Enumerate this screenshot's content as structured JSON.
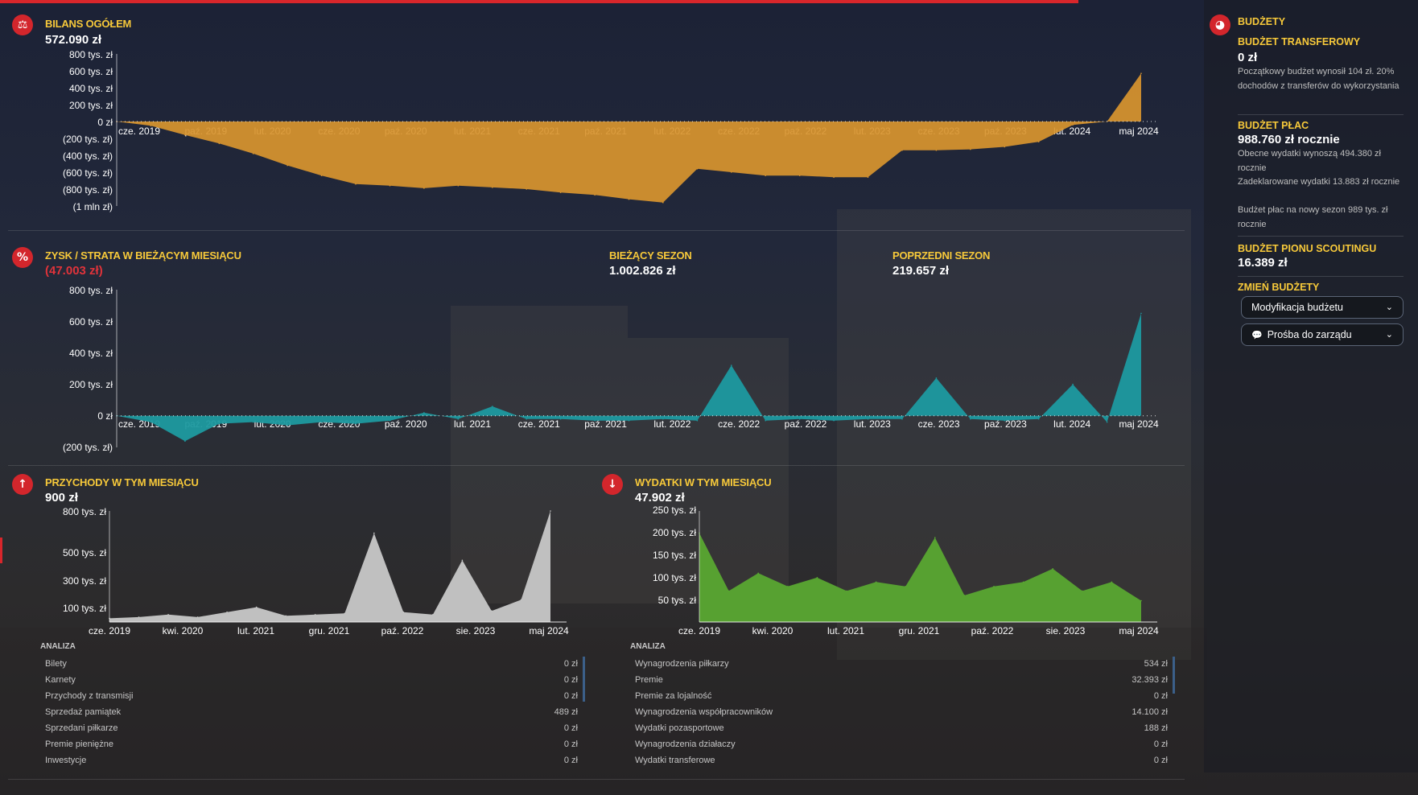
{
  "balance": {
    "title": "BILANS OGÓŁEM",
    "value": "572.090 zł",
    "icon": "balance-icon",
    "color": "#d9952f",
    "y_labels": [
      "800 tys. zł",
      "600 tys. zł",
      "400 tys. zł",
      "200 tys. zł",
      "0 zł",
      "(200 tys. zł)",
      "(400 tys. zł)",
      "(600 tys. zł)",
      "(800 tys. zł)",
      "(1 mln zł)"
    ],
    "x_labels": [
      "cze. 2019",
      "paź. 2019",
      "lut. 2020",
      "cze. 2020",
      "paź. 2020",
      "lut. 2021",
      "cze. 2021",
      "paź. 2021",
      "lut. 2022",
      "cze. 2022",
      "paź. 2022",
      "lut. 2023",
      "cze. 2023",
      "paź. 2023",
      "lut. 2024",
      "maj 2024"
    ]
  },
  "profit": {
    "title": "ZYSK / STRATA W BIEŻĄCYM MIESIĄCU",
    "value": "(47.003 zł)",
    "icon": "percent-icon",
    "color": "#1d9aa0",
    "current_season_label": "BIEŻĄCY SEZON",
    "current_season_value": "1.002.826 zł",
    "previous_season_label": "POPRZEDNI SEZON",
    "previous_season_value": "219.657 zł",
    "y_labels": [
      "800 tys. zł",
      "600 tys. zł",
      "400 tys. zł",
      "200 tys. zł",
      "0 zł",
      "(200 tys. zł)"
    ],
    "x_labels": [
      "cze. 2019",
      "paź. 2019",
      "lut. 2020",
      "cze. 2020",
      "paź. 2020",
      "lut. 2021",
      "cze. 2021",
      "paź. 2021",
      "lut. 2022",
      "cze. 2022",
      "paź. 2022",
      "lut. 2023",
      "cze. 2023",
      "paź. 2023",
      "lut. 2024",
      "maj 2024"
    ]
  },
  "income": {
    "title": "PRZYCHODY W TYM MIESIĄCU",
    "value": "900 zł",
    "icon": "arrow-up-icon",
    "color": "#c8c8c8",
    "y_labels": [
      "800 tys. zł",
      "500 tys. zł",
      "300 tys. zł",
      "100 tys. zł"
    ],
    "x_labels": [
      "cze. 2019",
      "kwi. 2020",
      "lut. 2021",
      "gru. 2021",
      "paź. 2022",
      "sie. 2023",
      "maj 2024"
    ],
    "analysis_title": "ANALIZA",
    "rows": [
      {
        "label": "Bilety",
        "value": "0 zł"
      },
      {
        "label": "Karnety",
        "value": "0 zł"
      },
      {
        "label": "Przychody z transmisji",
        "value": "0 zł"
      },
      {
        "label": "Sprzedaż pamiątek",
        "value": "489 zł"
      },
      {
        "label": "Sprzedani piłkarze",
        "value": "0 zł"
      },
      {
        "label": "Premie pieniężne",
        "value": "0 zł"
      },
      {
        "label": "Inwestycje",
        "value": "0 zł"
      }
    ]
  },
  "expenses": {
    "title": "WYDATKI W TYM MIESIĄCU",
    "value": "47.902 zł",
    "icon": "arrow-down-icon",
    "color": "#5aa832",
    "y_labels": [
      "250 tys. zł",
      "200 tys. zł",
      "150 tys. zł",
      "100 tys. zł",
      "50 tys. zł"
    ],
    "x_labels": [
      "cze. 2019",
      "kwi. 2020",
      "lut. 2021",
      "gru. 2021",
      "paź. 2022",
      "sie. 2023",
      "maj 2024"
    ],
    "analysis_title": "ANALIZA",
    "rows": [
      {
        "label": "Wynagrodzenia piłkarzy",
        "value": "534 zł"
      },
      {
        "label": "Premie",
        "value": "32.393 zł"
      },
      {
        "label": "Premie za lojalność",
        "value": "0 zł"
      },
      {
        "label": "Wynagrodzenia współpracowników",
        "value": "14.100 zł"
      },
      {
        "label": "Wydatki pozasportowe",
        "value": "188 zł"
      },
      {
        "label": "Wynagrodzenia działaczy",
        "value": "0 zł"
      },
      {
        "label": "Wydatki transferowe",
        "value": "0 zł"
      }
    ]
  },
  "budgets": {
    "title": "BUDŻETY",
    "icon": "piggy-bank-icon",
    "transfer": {
      "title": "BUDŻET TRANSFEROWY",
      "value": "0 zł",
      "text": "Początkowy budżet wynosił 104 zł. 20% dochodów z transferów do wykorzystania"
    },
    "wage": {
      "title": "BUDŻET PŁAC",
      "value": "988.760 zł rocznie",
      "lines": [
        "Obecne wydatki wynoszą 494.380 zł rocznie",
        "Zadeklarowane wydatki 13.883 zł rocznie",
        "Budżet płac na nowy sezon 989 tys. zł rocznie"
      ]
    },
    "scouting": {
      "title": "BUDŻET PIONU SCOUTINGU",
      "value": "16.389 zł"
    },
    "change": {
      "title": "ZMIEŃ BUDŻETY",
      "modify_label": "Modyfikacja budżetu",
      "request_label": "Prośba do zarządu"
    }
  },
  "chart_data": [
    {
      "type": "area",
      "title": "BILANS OGÓŁEM",
      "x": [
        "2019-06",
        "2019-08",
        "2019-10",
        "2019-12",
        "2020-02",
        "2020-04",
        "2020-06",
        "2020-08",
        "2020-10",
        "2020-12",
        "2021-02",
        "2021-04",
        "2021-06",
        "2021-08",
        "2021-10",
        "2021-12",
        "2022-02",
        "2022-04",
        "2022-06",
        "2022-08",
        "2022-10",
        "2022-12",
        "2023-02",
        "2023-04",
        "2023-06",
        "2023-08",
        "2023-10",
        "2023-12",
        "2024-02",
        "2024-04",
        "2024-05"
      ],
      "values": [
        0,
        -50000,
        -160000,
        -260000,
        -380000,
        -520000,
        -640000,
        -740000,
        -760000,
        -790000,
        -760000,
        -780000,
        -800000,
        -840000,
        -870000,
        -920000,
        -960000,
        -560000,
        -600000,
        -640000,
        -640000,
        -660000,
        -660000,
        -340000,
        -340000,
        -330000,
        -300000,
        -240000,
        -40000,
        0,
        570000
      ],
      "ylim": [
        -1000000,
        800000
      ]
    },
    {
      "type": "area",
      "title": "ZYSK / STRATA W BIEŻĄCYM MIESIĄCU",
      "x": [
        "2019-06",
        "2019-08",
        "2019-10",
        "2019-12",
        "2020-02",
        "2020-04",
        "2020-06",
        "2020-08",
        "2020-10",
        "2020-12",
        "2021-02",
        "2021-04",
        "2021-06",
        "2021-08",
        "2021-10",
        "2021-12",
        "2022-02",
        "2022-04",
        "2022-06",
        "2022-08",
        "2022-10",
        "2022-12",
        "2023-02",
        "2023-04",
        "2023-06",
        "2023-08",
        "2023-10",
        "2023-12",
        "2024-02",
        "2024-04",
        "2024-05"
      ],
      "values": [
        0,
        -40000,
        -160000,
        -50000,
        -40000,
        -60000,
        -40000,
        -50000,
        -30000,
        20000,
        -20000,
        60000,
        -20000,
        -20000,
        -30000,
        -30000,
        -20000,
        -30000,
        320000,
        -30000,
        -20000,
        -30000,
        -20000,
        -20000,
        240000,
        -20000,
        -30000,
        -20000,
        200000,
        -40000,
        650000
      ],
      "ylim": [
        -200000,
        800000
      ]
    },
    {
      "type": "area",
      "title": "PRZYCHODY W TYM MIESIĄCU",
      "x": [
        "2019-06",
        "2019-10",
        "2020-02",
        "2020-06",
        "2020-10",
        "2021-02",
        "2021-06",
        "2021-10",
        "2022-02",
        "2022-06",
        "2022-10",
        "2023-02",
        "2023-06",
        "2023-10",
        "2024-02",
        "2024-05"
      ],
      "values": [
        30000,
        40000,
        60000,
        40000,
        80000,
        120000,
        50000,
        60000,
        70000,
        720000,
        80000,
        60000,
        500000,
        90000,
        180000,
        900000
      ],
      "ylim": [
        0,
        900000
      ]
    },
    {
      "type": "area",
      "title": "WYDATKI W TYM MIESIĄCU",
      "x": [
        "2019-06",
        "2019-10",
        "2020-02",
        "2020-06",
        "2020-10",
        "2021-02",
        "2021-06",
        "2021-10",
        "2022-02",
        "2022-06",
        "2022-10",
        "2023-02",
        "2023-06",
        "2023-10",
        "2024-02",
        "2024-05"
      ],
      "values": [
        200000,
        70000,
        110000,
        80000,
        100000,
        70000,
        90000,
        80000,
        190000,
        60000,
        80000,
        90000,
        120000,
        70000,
        90000,
        48000
      ],
      "ylim": [
        0,
        250000
      ]
    }
  ]
}
